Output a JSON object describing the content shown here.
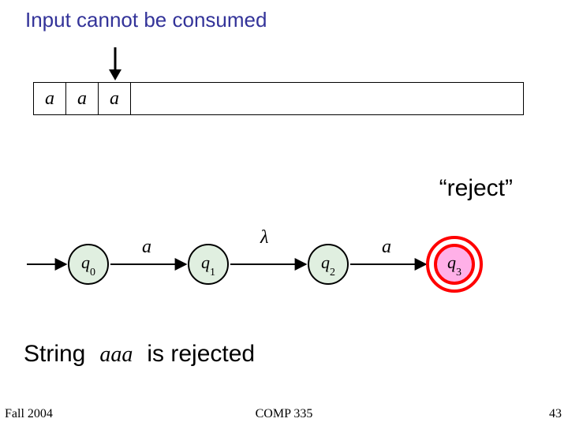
{
  "title": "Input cannot be consumed",
  "tape": {
    "cells": [
      "a",
      "a",
      "a"
    ],
    "head_index": 2
  },
  "reject_label": "“reject”",
  "automaton": {
    "states": [
      {
        "name": "q",
        "sub": "0"
      },
      {
        "name": "q",
        "sub": "1"
      },
      {
        "name": "q",
        "sub": "2"
      },
      {
        "name": "q",
        "sub": "3",
        "accepting": true,
        "highlight": true
      }
    ],
    "transitions": [
      {
        "label": "a"
      },
      {
        "label": "λ"
      },
      {
        "label": "a"
      }
    ]
  },
  "conclusion": {
    "prefix": "String",
    "string": "aaa",
    "suffix": "is rejected"
  },
  "footer": {
    "left": "Fall 2004",
    "center": "COMP 335",
    "right": "43"
  },
  "colors": {
    "title": "#333399",
    "state_fill": "#e0efe0",
    "accept_border": "#ff0000",
    "accept_fill": "#ffb0e8"
  }
}
